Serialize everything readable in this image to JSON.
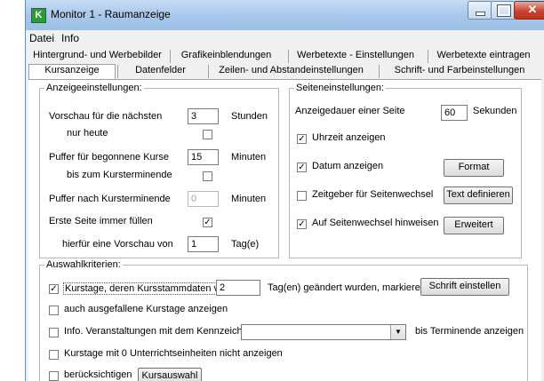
{
  "window": {
    "title": "Monitor 1 - Raumanzeige",
    "icon": "K"
  },
  "menu": [
    "Datei",
    "Info"
  ],
  "tabs_row1": [
    "Hintergrund- und Werbebilder",
    "Grafikeinblendungen",
    "Werbetexte - Einstellungen",
    "Werbetexte eintragen"
  ],
  "tabs_row2": [
    "Kursanzeige",
    "Datenfelder",
    "Zeilen- und Abstandeinstellungen",
    "Schrift- und Farbeinstellungen"
  ],
  "anzeige": {
    "legend": "Anzeigeeinstellungen:",
    "vorschau_label": "Vorschau für die nächsten",
    "vorschau_value": "3",
    "vorschau_unit": "Stunden",
    "nur_heute_label": "nur heute",
    "nur_heute_checked": false,
    "puffer_label": "Puffer für begonnene Kurse",
    "puffer_value": "15",
    "puffer_unit": "Minuten",
    "bis_kursende_label": "bis zum Kursterminende",
    "bis_kursende_checked": false,
    "puffer_nach_label": "Puffer nach Kursterminende",
    "puffer_nach_value": "0",
    "puffer_nach_unit": "Minuten",
    "erste_seite_label": "Erste Seite immer füllen",
    "erste_seite_checked": true,
    "hierfuer_label": "hierfür eine Vorschau von",
    "hierfuer_value": "1",
    "hierfuer_unit": "Tag(e)"
  },
  "seiten": {
    "legend": "Seiteneinstellungen:",
    "dauer_label": "Anzeigedauer einer Seite",
    "dauer_value": "60",
    "dauer_unit": "Sekunden",
    "uhrzeit_label": "Uhrzeit anzeigen",
    "uhrzeit_checked": true,
    "datum_label": "Datum anzeigen",
    "datum_checked": true,
    "format_button": "Format",
    "zeitgeber_label": "Zeitgeber für Seitenwechsel",
    "zeitgeber_checked": false,
    "text_button": "Text definieren",
    "hinweis_label": "Auf Seitenwechsel hinweisen",
    "hinweis_checked": true,
    "erweitert_button": "Erweitert"
  },
  "auswahl": {
    "legend": "Auswahlkriterien:",
    "kurstage_label": "Kurstage, deren Kursstammdaten vor",
    "kurstage_checked": true,
    "kurstage_value": "2",
    "kurstage_suffix": "Tag(en) geändert wurden, markieren",
    "schrift_button": "Schrift einstellen",
    "ausgefallen_label": "auch ausgefallene Kurstage anzeigen",
    "ausgefallen_checked": false,
    "info_label": "Info. Veranstaltungen mit dem Kennzeichen",
    "info_checked": false,
    "info_combo_value": "",
    "info_suffix": "bis Terminende anzeigen",
    "null_label": "Kurstage mit 0 Unterrichtseinheiten nicht anzeigen",
    "null_checked": false,
    "beruecksichtigen_label": "berücksichtigen",
    "beruecksichtigen_checked": false,
    "kursauswahl_button": "Kursauswahl"
  }
}
